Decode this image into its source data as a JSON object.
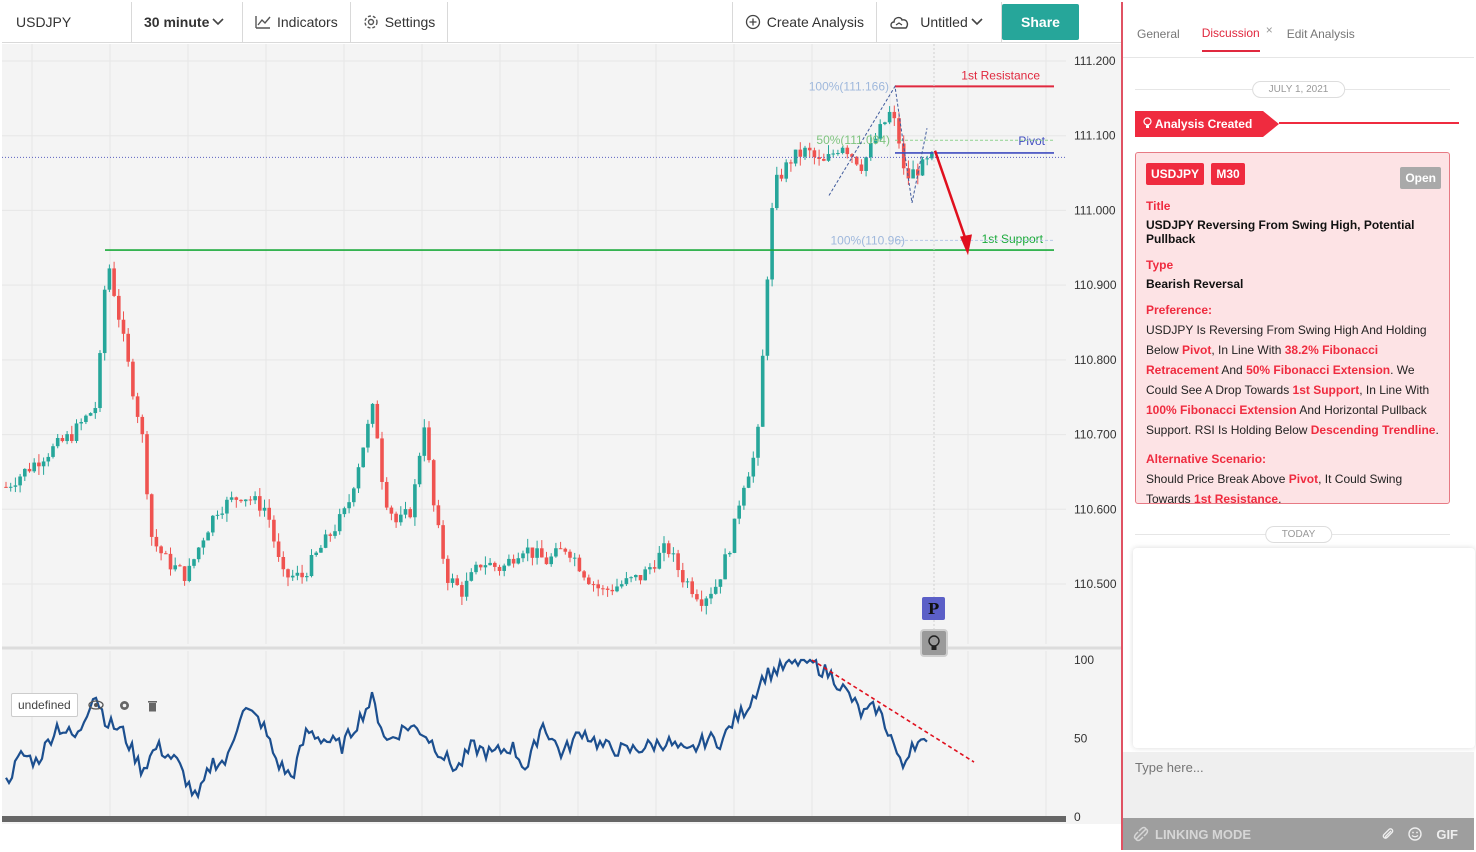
{
  "toolbar": {
    "symbol": "USDJPY",
    "interval": "30 minute",
    "indicators": "Indicators",
    "settings": "Settings",
    "create_analysis": "Create Analysis",
    "untitled": "Untitled",
    "share": "Share"
  },
  "chart": {
    "price_labels": [
      "111.200",
      "111.100",
      "111.000",
      "110.900",
      "110.800",
      "110.700",
      "110.600",
      "110.500"
    ],
    "osc_labels": [
      "100",
      "50",
      "0"
    ],
    "annotations": {
      "resistance": "1st Resistance",
      "support": "1st Support",
      "pivot": "Pivot",
      "fib_top": "100%(111.166)",
      "fib_bottom": "100%(110.96)",
      "fib_mid": "50%(111.094)"
    },
    "indicator_name": "undefined",
    "colors": {
      "up": "#26a69a",
      "down": "#ef5350",
      "resistance": "#e0283e",
      "support": "#1aaa3a",
      "pivot": "#3f4cc0",
      "rsi": "#1c4f8f"
    },
    "badge_p": "P"
  },
  "side": {
    "tabs": [
      "General",
      "Discussion",
      "Edit Analysis"
    ],
    "tab_close": "×",
    "date1": "JULY 1, 2021",
    "date2": "TODAY",
    "created_tag": "Analysis Created",
    "chip_symbol": "USDJPY",
    "chip_tf": "M30",
    "chip_status": "Open",
    "title_label": "Title",
    "title_value": "USDJPY Reversing From Swing High, Potential Pullback",
    "type_label": "Type",
    "type_value": "Bearish Reversal",
    "pref_label": "Preference:",
    "pref_parts": [
      "USDJPY Is Reversing From Swing High And Holding Below ",
      "Pivot",
      ", In Line With ",
      "38.2% Fibonacci Retracement",
      " And ",
      "50% Fibonacci Extension",
      ". We Could See A Drop Towards ",
      "1st Support",
      ", In Line With ",
      "100% Fibonacci Extension",
      " And Horizontal Pullback Support. RSI Is Holding Below ",
      "Descending Trendline",
      "."
    ],
    "alt_label": "Alternative Scenario:",
    "alt_parts": [
      "Should Price Break Above ",
      "Pivot",
      ", It Could Swing Towards ",
      "1st Resistance",
      "."
    ],
    "input_placeholder": "Type here...",
    "linking_mode": "LINKING MODE",
    "gif": "GIF"
  }
}
